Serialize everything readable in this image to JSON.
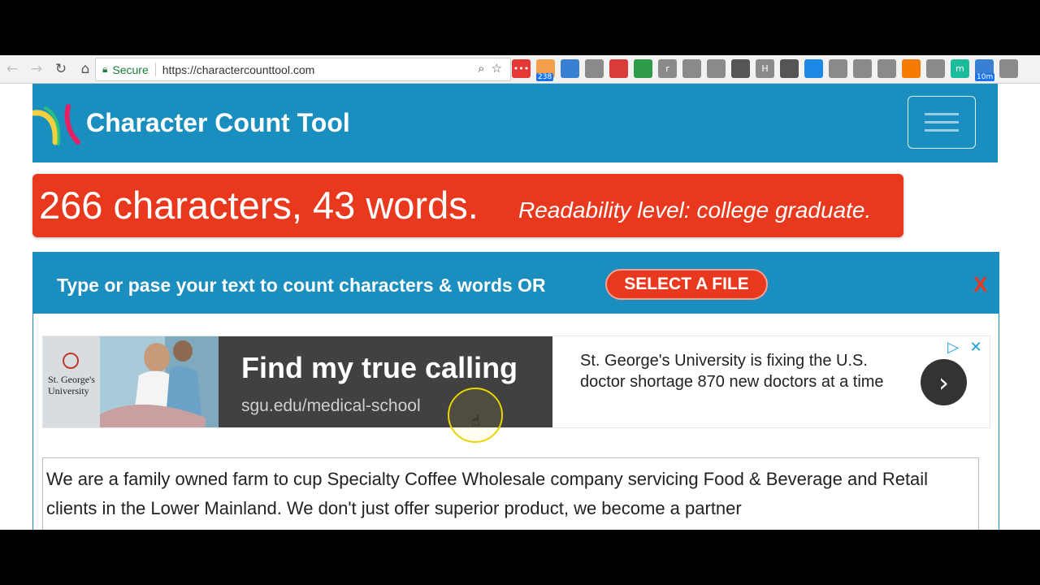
{
  "browser": {
    "secure_label": "Secure",
    "url": "https://charactercounttool.com",
    "extensions": [
      {
        "icon": "ext-red-dots-icon",
        "color": "#e53935",
        "label": "•••",
        "badge": ""
      },
      {
        "icon": "ext-counter-icon",
        "color": "#f4a04a",
        "label": "",
        "badge": "238"
      },
      {
        "icon": "ext-window-icon",
        "color": "#3a80d2",
        "label": "",
        "badge": ""
      },
      {
        "icon": "ext-camera-icon",
        "color": "#8a8a8a",
        "label": "",
        "badge": ""
      },
      {
        "icon": "ext-record-icon",
        "color": "#d93a3a",
        "label": "",
        "badge": ""
      },
      {
        "icon": "ext-wave-icon",
        "color": "#2e9b4a",
        "label": "",
        "badge": ""
      },
      {
        "icon": "ext-r-icon",
        "color": "#8a8a8a",
        "label": "r",
        "badge": ""
      },
      {
        "icon": "ext-pen-icon",
        "color": "#8a8a8a",
        "label": "",
        "badge": ""
      },
      {
        "icon": "ext-compass-icon",
        "color": "#8a8a8a",
        "label": "",
        "badge": ""
      },
      {
        "icon": "ext-crop-icon",
        "color": "#555555",
        "label": "",
        "badge": ""
      },
      {
        "icon": "ext-h-icon",
        "color": "#8a8a8a",
        "label": "H",
        "badge": ""
      },
      {
        "icon": "ext-eyedropper-icon",
        "color": "#555555",
        "label": "",
        "badge": ""
      },
      {
        "icon": "ext-trello-icon",
        "color": "#1e88e5",
        "label": "",
        "badge": ""
      },
      {
        "icon": "ext-chat-icon",
        "color": "#8a8a8a",
        "label": "",
        "badge": ""
      },
      {
        "icon": "ext-m-icon",
        "color": "#8a8a8a",
        "label": "",
        "badge": ""
      },
      {
        "icon": "ext-cloud-icon",
        "color": "#8a8a8a",
        "label": "",
        "badge": ""
      },
      {
        "icon": "ext-fire-icon",
        "color": "#f57c00",
        "label": "",
        "badge": ""
      },
      {
        "icon": "ext-power-icon",
        "color": "#8a8a8a",
        "label": "",
        "badge": ""
      },
      {
        "icon": "ext-teal-m-icon",
        "color": "#1abc9c",
        "label": "m",
        "badge": ""
      },
      {
        "icon": "ext-timer-icon",
        "color": "#3a80d2",
        "label": "",
        "badge": "10m"
      },
      {
        "icon": "ext-grey-box-icon",
        "color": "#8a8a8a",
        "label": "",
        "badge": ""
      }
    ]
  },
  "site": {
    "title": "Character Count Tool"
  },
  "stats": {
    "counts": "266 characters, 43 words.",
    "readability": "Readability level: college graduate."
  },
  "panel": {
    "prompt": "Type or pase your text to count characters & words OR",
    "select_file": "SELECT A FILE",
    "close": "X"
  },
  "ad": {
    "headline": "Find my true calling",
    "url": "sgu.edu/medical-school",
    "description": "St. George's University is fixing the U.S. doctor shortage 870 new doctors at a time",
    "image_caption_1": "St. George's",
    "image_caption_2": "University"
  },
  "editor": {
    "text": "We are a family owned farm to cup Specialty Coffee Wholesale company servicing Food & Beverage and Retail clients in the Lower Mainland.  We don't just offer superior product, we become a partner"
  },
  "colors": {
    "brand_blue": "#1b8ec0",
    "accent_red": "#e8391e"
  }
}
